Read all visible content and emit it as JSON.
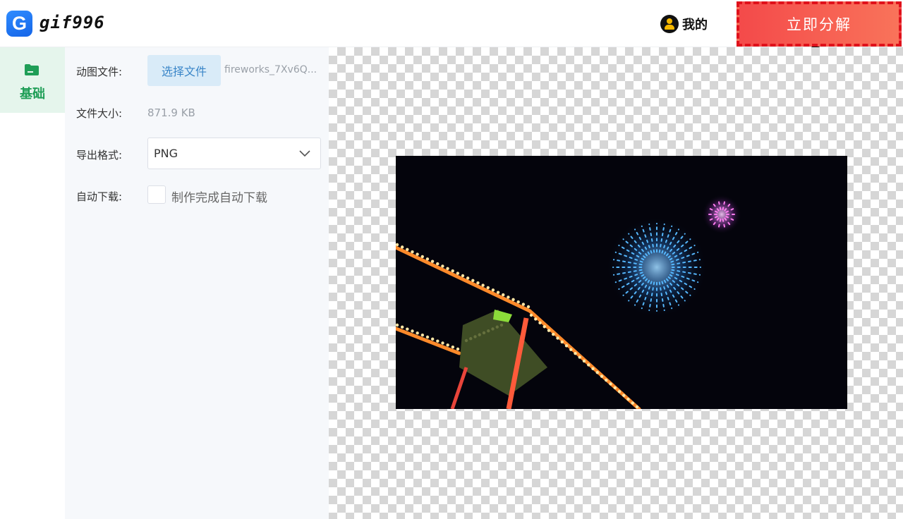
{
  "header": {
    "logo_letter": "G",
    "app_name": "gif996",
    "user_label": "我的",
    "cta_label": "立即分解"
  },
  "sidebar": {
    "tabs": [
      {
        "label": "基础",
        "icon": "folder-icon",
        "active": true
      }
    ]
  },
  "form": {
    "file_label": "动图文件:",
    "choose_button": "选择文件",
    "file_name": "fireworks_7Xv6Q...",
    "size_label": "文件大小:",
    "size_value": "871.9 KB",
    "format_label": "导出格式:",
    "format_value": "PNG",
    "autodl_label": "自动下载:",
    "autodl_checkbox_label": "制作完成自动下载",
    "autodl_checked": false
  },
  "preview": {
    "image_description_icon": "fireworks-preview-image"
  },
  "colors": {
    "brand_blue": "#1f6ff0",
    "accent_green": "#1f9e57",
    "cta_red": "#f44a4a",
    "arrow_red": "#e0202a"
  }
}
